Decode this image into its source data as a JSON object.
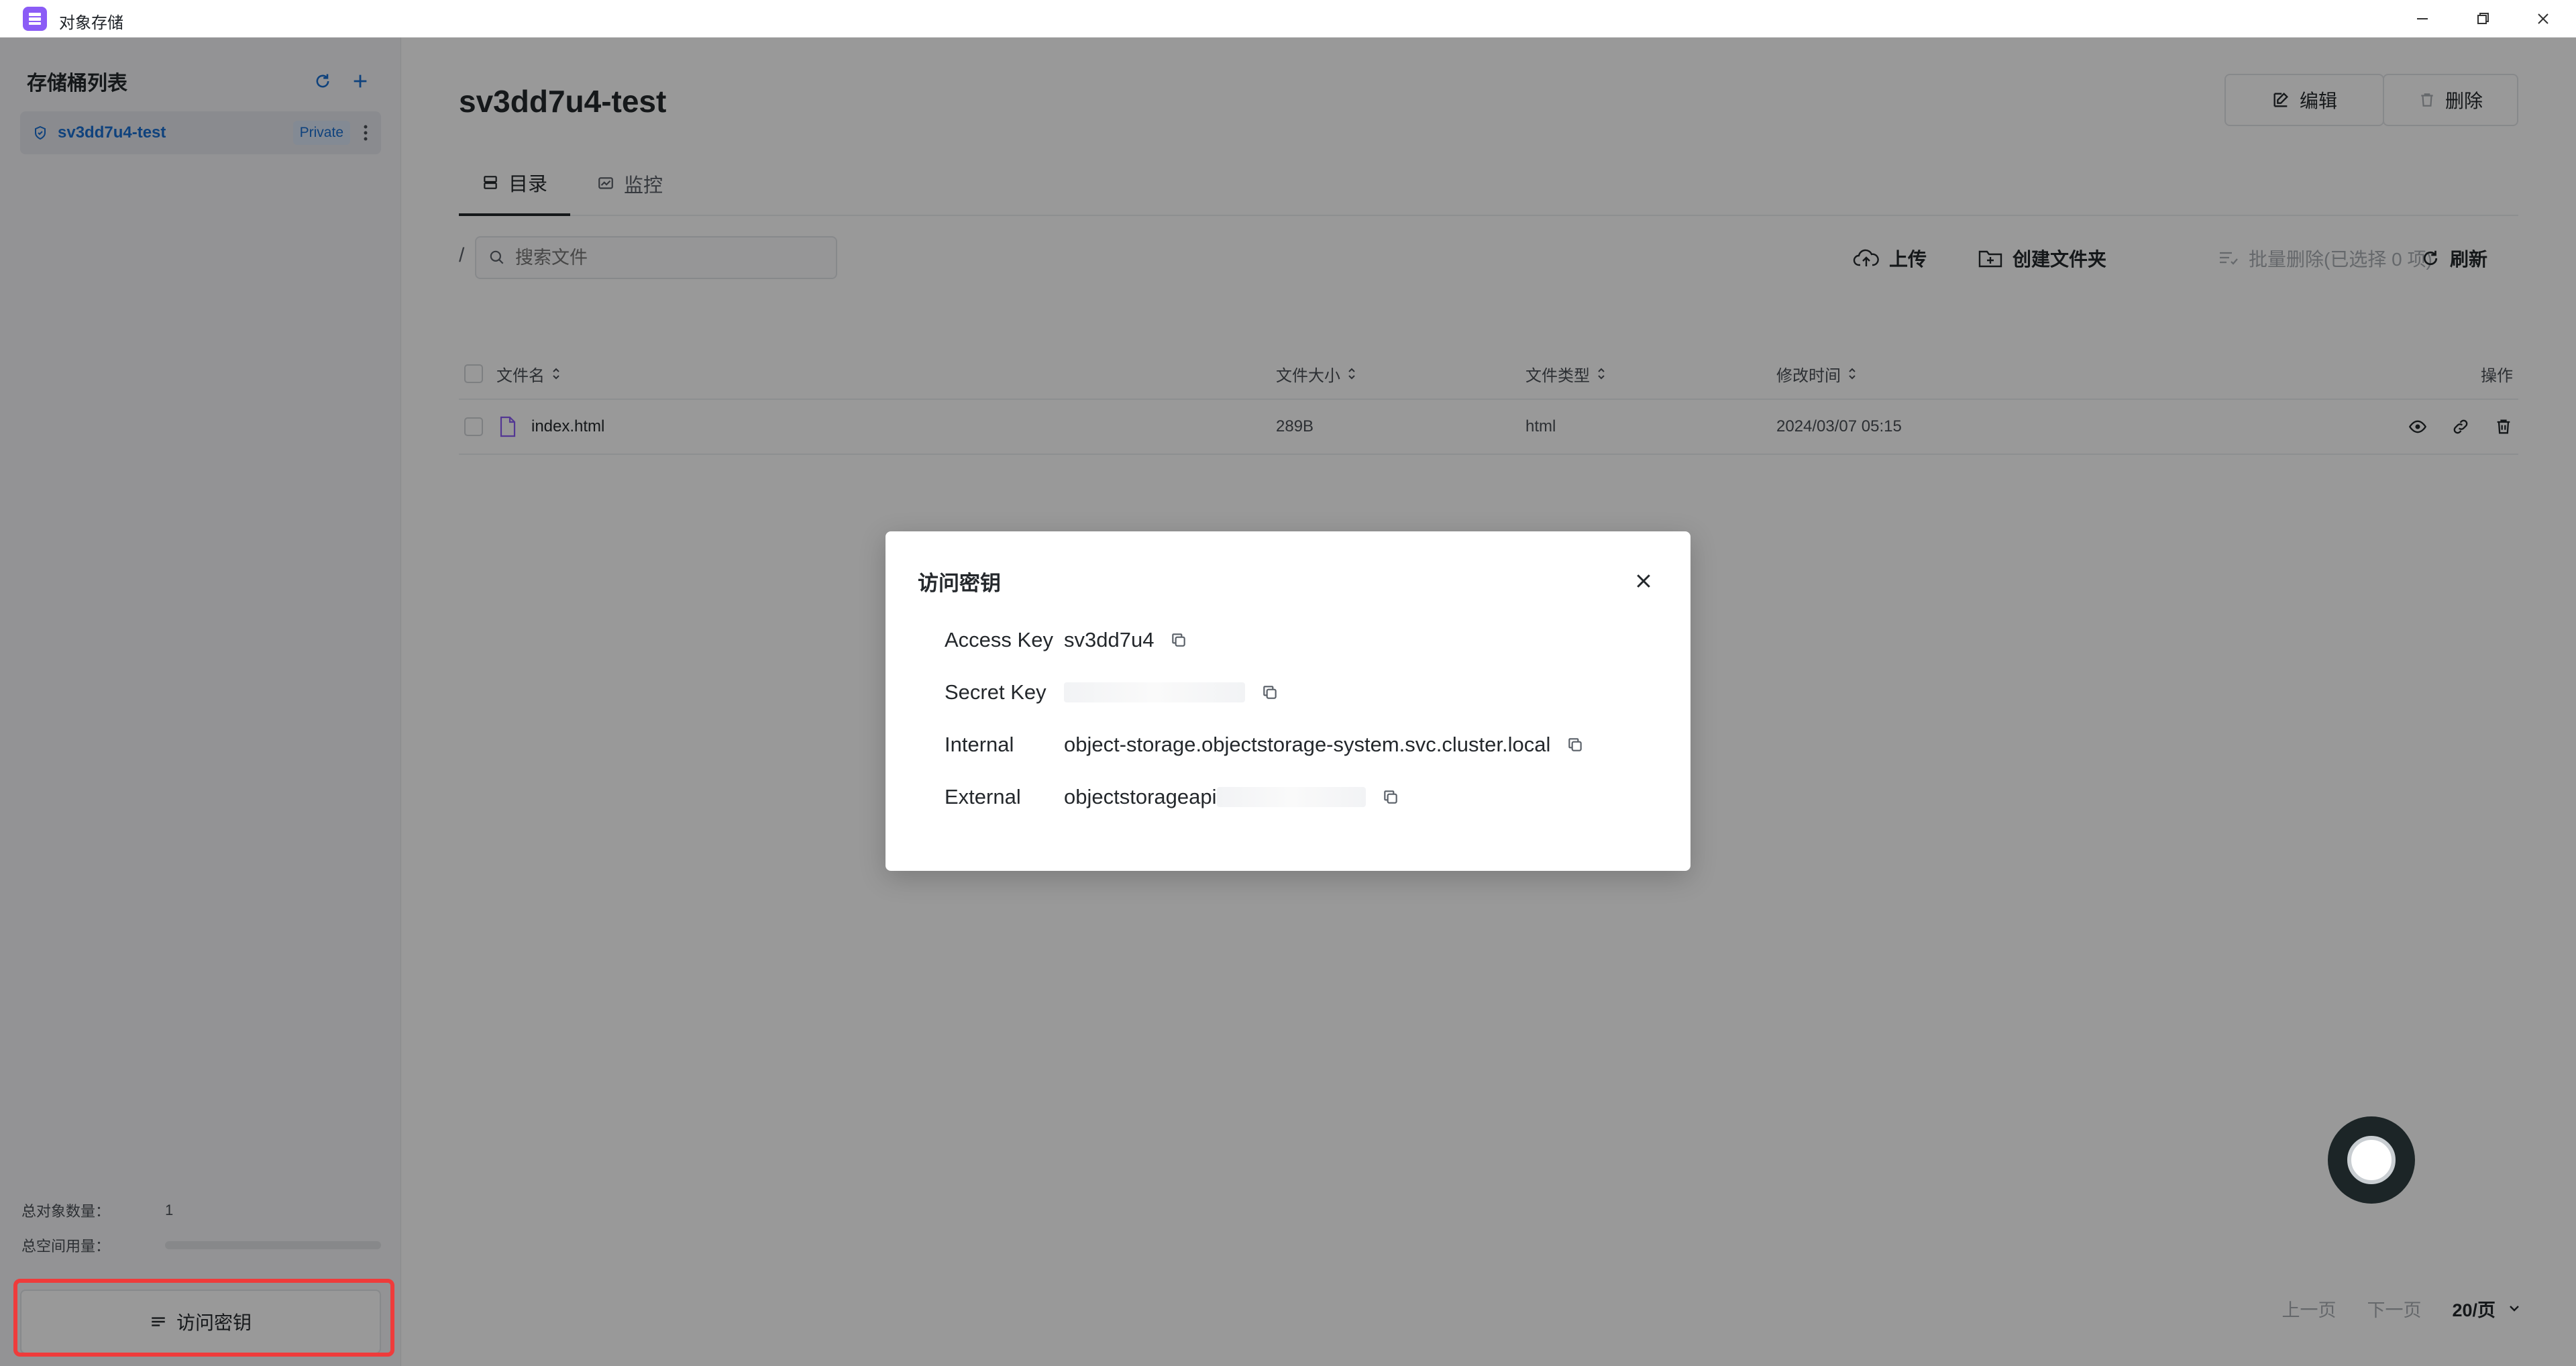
{
  "window": {
    "title": "对象存储"
  },
  "sidebar": {
    "title": "存储桶列表",
    "buckets": [
      {
        "name": "sv3dd7u4-test",
        "badge": "Private"
      }
    ],
    "stats": {
      "objects_label": "总对象数量：",
      "objects_value": "1",
      "space_label": "总空间用量："
    },
    "access_key_button": "访问密钥"
  },
  "main": {
    "title": "sv3dd7u4-test",
    "edit_label": "编辑",
    "delete_label": "删除",
    "tabs": [
      {
        "label": "目录"
      },
      {
        "label": "监控"
      }
    ],
    "path": "/",
    "search_placeholder": "搜索文件",
    "toolbar": {
      "upload": "上传",
      "create_folder": "创建文件夹",
      "batch_delete": "批量删除(已选择 0 项)",
      "refresh": "刷新"
    },
    "table": {
      "columns": {
        "name": "文件名",
        "size": "文件大小",
        "type": "文件类型",
        "modified": "修改时间",
        "actions": "操作"
      },
      "rows": [
        {
          "name": "index.html",
          "size": "289B",
          "type": "html",
          "modified": "2024/03/07 05:15"
        }
      ]
    },
    "pager": {
      "prev": "上一页",
      "next": "下一页",
      "size": "20/页"
    }
  },
  "modal": {
    "title": "访问密钥",
    "items": [
      {
        "label": "Access Key",
        "value": "sv3dd7u4"
      },
      {
        "label": "Secret Key",
        "value": ""
      },
      {
        "label": "Internal",
        "value": "object-storage.objectstorage-system.svc.cluster.local"
      },
      {
        "label": "External",
        "value": "objectstorageapi"
      }
    ]
  },
  "colors": {
    "accent": "#1a6fd0",
    "highlight": "#ef3b3b",
    "app_icon": "#8b5cf6"
  }
}
